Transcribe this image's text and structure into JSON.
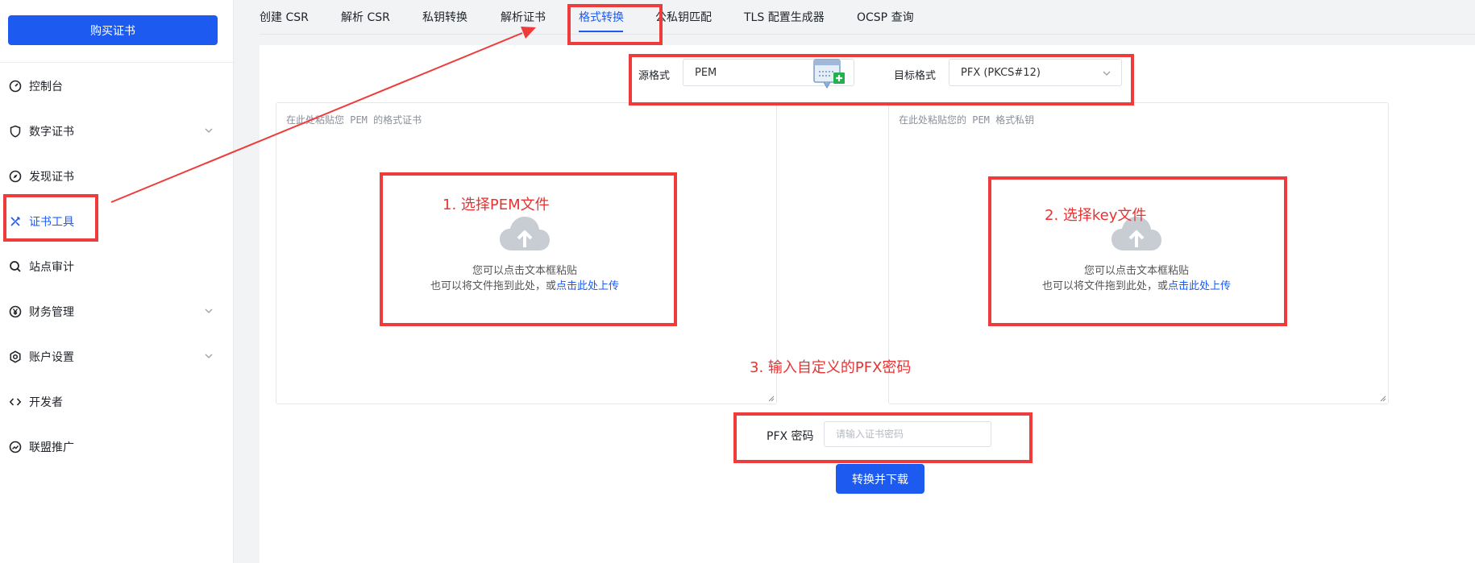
{
  "sidebar": {
    "buy_label": "购买证书",
    "items": [
      {
        "label": "控制台",
        "icon": "dashboard-icon"
      },
      {
        "label": "数字证书",
        "icon": "shield-icon",
        "expandable": true
      },
      {
        "label": "发现证书",
        "icon": "compass-icon"
      },
      {
        "label": "证书工具",
        "icon": "tools-icon",
        "active": true
      },
      {
        "label": "站点审计",
        "icon": "search-icon"
      },
      {
        "label": "财务管理",
        "icon": "yen-icon",
        "expandable": true
      },
      {
        "label": "账户设置",
        "icon": "settings-icon",
        "expandable": true
      },
      {
        "label": "开发者",
        "icon": "code-icon"
      },
      {
        "label": "联盟推广",
        "icon": "trend-icon"
      }
    ]
  },
  "tabs": [
    {
      "label": "创建 CSR"
    },
    {
      "label": "解析 CSR"
    },
    {
      "label": "私钥转换"
    },
    {
      "label": "解析证书"
    },
    {
      "label": "格式转换",
      "active": true
    },
    {
      "label": "公私钥匹配"
    },
    {
      "label": "TLS 配置生成器"
    },
    {
      "label": "OCSP 查询"
    }
  ],
  "converter": {
    "source_label": "源格式",
    "source_value": "PEM",
    "target_label": "目标格式",
    "target_value": "PFX (PKCS#12)",
    "cert_placeholder": "在此处粘贴您 PEM 的格式证书",
    "key_placeholder": "在此处粘贴您的 PEM 格式私钥",
    "upload_hint_line1": "您可以点击文本框粘贴",
    "upload_hint_line2": "也可以将文件拖到此处，或",
    "upload_link": "点击此处上传",
    "pfx_password_label": "PFX 密码",
    "pfx_password_placeholder": "请输入证书密码",
    "convert_button": "转换并下载"
  },
  "annotations": {
    "step1": "1. 选择PEM文件",
    "step2": "2. 选择key文件",
    "step3": "3. 输入自定义的PFX密码"
  },
  "colors": {
    "accent": "#1d5bf0",
    "annotation": "#ee3b3b"
  }
}
